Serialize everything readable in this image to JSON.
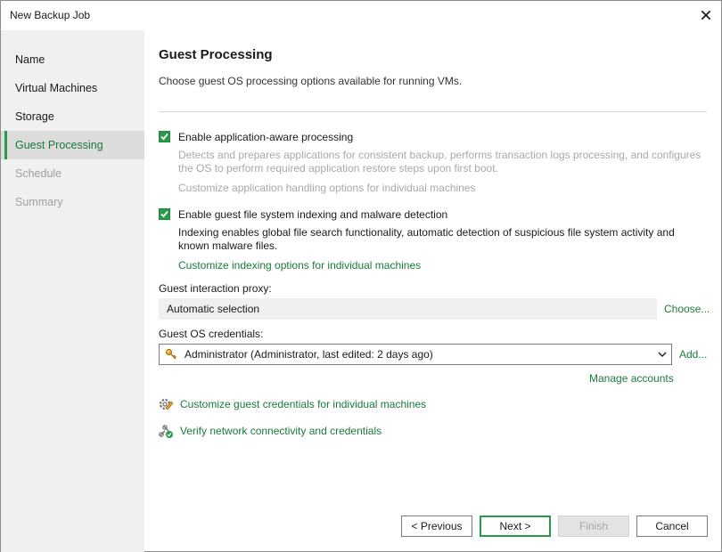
{
  "window": {
    "title": "New Backup Job"
  },
  "sidebar": {
    "items": [
      {
        "label": "Name",
        "state": "normal"
      },
      {
        "label": "Virtual Machines",
        "state": "normal"
      },
      {
        "label": "Storage",
        "state": "normal"
      },
      {
        "label": "Guest Processing",
        "state": "active"
      },
      {
        "label": "Schedule",
        "state": "disabled"
      },
      {
        "label": "Summary",
        "state": "disabled"
      }
    ]
  },
  "main": {
    "title": "Guest Processing",
    "subtitle": "Choose guest OS processing options available for running VMs.",
    "app_aware": {
      "checked": true,
      "label": "Enable application-aware processing",
      "desc_line1": "Detects and prepares applications for consistent backup, performs transaction logs processing, and configures",
      "desc_line2": "the OS to perform required application restore steps upon first boot.",
      "customize_label": "Customize application handling options for individual machines"
    },
    "indexing": {
      "checked": true,
      "label": "Enable guest file system indexing and malware detection",
      "desc_line1": "Indexing enables global file search functionality, automatic detection of suspicious file system activity and",
      "desc_line2": "known malware files.",
      "customize_label": "Customize indexing options for individual machines"
    },
    "proxy": {
      "label": "Guest interaction proxy:",
      "value": "Automatic selection",
      "choose_label": "Choose..."
    },
    "credentials": {
      "label": "Guest OS credentials:",
      "value": "Administrator (Administrator, last edited: 2 days ago)",
      "add_label": "Add...",
      "manage_label": "Manage accounts"
    },
    "links": {
      "customize_creds": "Customize guest credentials for individual machines",
      "verify": "Verify network connectivity and credentials"
    }
  },
  "footer": {
    "previous": "< Previous",
    "next": "Next >",
    "finish": "Finish",
    "cancel": "Cancel"
  },
  "colors": {
    "accent": "#2a9a4a",
    "link": "#1a7a3a",
    "sidebar_bg": "#f0f0f0",
    "sidebar_active_bg": "#dcdcdc"
  }
}
